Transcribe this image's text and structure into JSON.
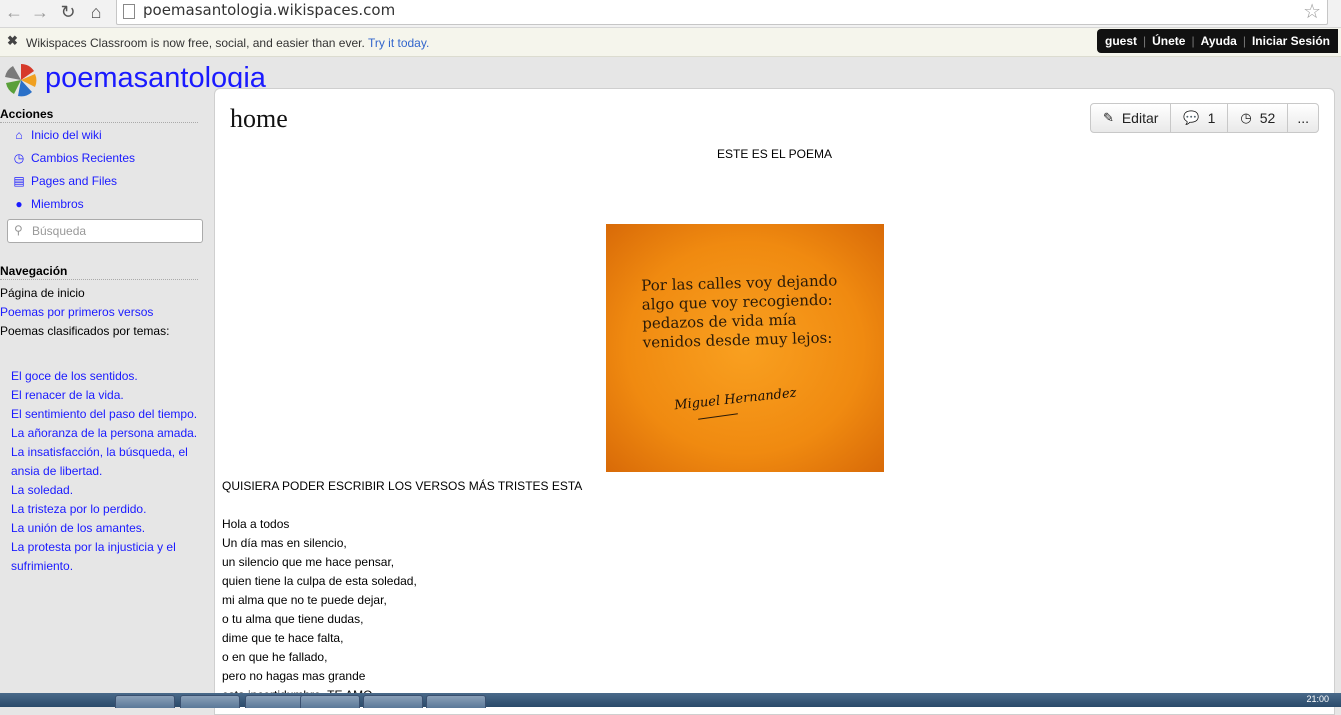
{
  "browser": {
    "url": "poemasantologia.wikispaces.com",
    "back_icon": "back-arrow-icon",
    "forward_icon": "forward-arrow-icon",
    "reload_icon": "reload-icon",
    "home_icon": "home-icon",
    "star_icon": "star-icon"
  },
  "notice": {
    "text": "Wikispaces Classroom is now free, social, and easier than ever.",
    "link": "Try it today."
  },
  "userbar": {
    "user": "guest",
    "join": "Únete",
    "help": "Ayuda",
    "login": "Iniciar Sesión"
  },
  "site": {
    "title": "poemasantologia"
  },
  "sidebar": {
    "actions_heading": "Acciones",
    "actions": [
      {
        "label": "Inicio del wiki",
        "icon": "home-icon"
      },
      {
        "label": "Cambios Recientes",
        "icon": "clock-icon"
      },
      {
        "label": "Pages and Files",
        "icon": "document-icon"
      },
      {
        "label": "Miembros",
        "icon": "user-icon"
      }
    ],
    "search_placeholder": "Búsqueda",
    "nav_heading": "Navegación",
    "nav": {
      "home": "Página de inicio",
      "first_verses": "Poemas por primeros versos",
      "by_theme": "Poemas clasificados por temas:"
    },
    "topics": [
      "El goce de los sentidos.",
      "El renacer de la vida.",
      "El sentimiento del paso del tiempo.",
      "La añoranza de la persona amada.",
      "La insatisfacción, la búsqueda, el ansia de libertad.",
      "La soledad.",
      "La tristeza por lo perdido.",
      "La unión de los amantes.",
      "La protesta por la injusticia y el sufrimiento."
    ]
  },
  "page": {
    "title": "home",
    "edit_label": "Editar",
    "comments_count": "1",
    "history_count": "52",
    "more_label": "...",
    "heading": "ESTE ES EL POEMA",
    "poster_lines": [
      "Por las calles voy dejando",
      "algo que voy recogiendo:",
      "pedazos de vida mía",
      "venidos desde muy lejos:"
    ],
    "poster_signature": "Miguel Hernandez",
    "subheading": "QUISIERA PODER ESCRIBIR LOS VERSOS MÁS TRISTES ESTA",
    "poem_lines": [
      "Hola a todos",
      "Un día mas en silencio,",
      "un silencio que me hace pensar,",
      "quien tiene la culpa de esta soledad,",
      "mi alma que no te puede dejar,",
      "o tu alma que tiene dudas,",
      "dime que te hace falta,",
      "o en que he fallado,",
      "pero no hagas mas grande",
      "esta incertidumbre. TE AMO"
    ]
  },
  "taskbar": {
    "clock": "21:00"
  }
}
